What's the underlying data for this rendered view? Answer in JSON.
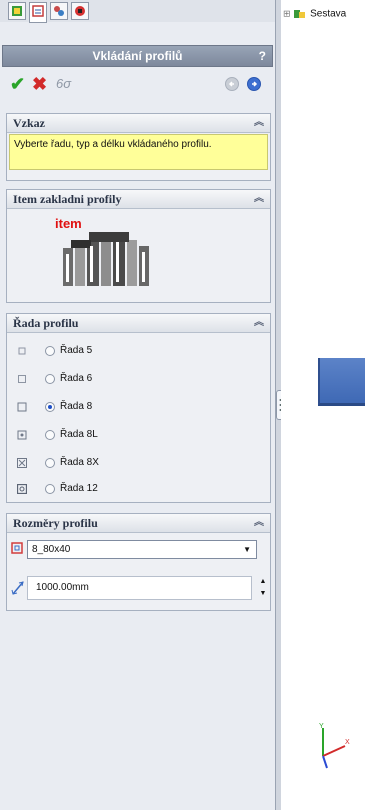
{
  "panel": {
    "title": "Vkládání profilů",
    "help": "?",
    "tabs": [
      "feature-manager-icon",
      "property-manager-icon",
      "configuration-manager-icon",
      "display-manager-icon"
    ],
    "actions": {
      "ok": "✔",
      "cancel": "✖",
      "preview": "6σ"
    }
  },
  "message": {
    "header": "Vzkaz",
    "text": "Vyberte řadu, typ a délku vkládaného profilu."
  },
  "item_group": {
    "header": "Item zakladni profily",
    "logo_text": "item"
  },
  "series_group": {
    "header": "Řada profilu",
    "options": [
      {
        "label": "Řada 5",
        "selected": false
      },
      {
        "label": "Řada 6",
        "selected": false
      },
      {
        "label": "Řada 8",
        "selected": true
      },
      {
        "label": "Řada 8L",
        "selected": false
      },
      {
        "label": "Řada 8X",
        "selected": false
      },
      {
        "label": "Řada 12",
        "selected": false
      }
    ]
  },
  "dims_group": {
    "header": "Rozměry profilu",
    "profile_value": "8_80x40",
    "length_value": "1000.00mm"
  },
  "tree": {
    "root_label": "Sestava"
  },
  "colors": {
    "part_blue": "#4a72bd",
    "message_bg": "#ffff99",
    "title_bar": "#8a96aa"
  }
}
